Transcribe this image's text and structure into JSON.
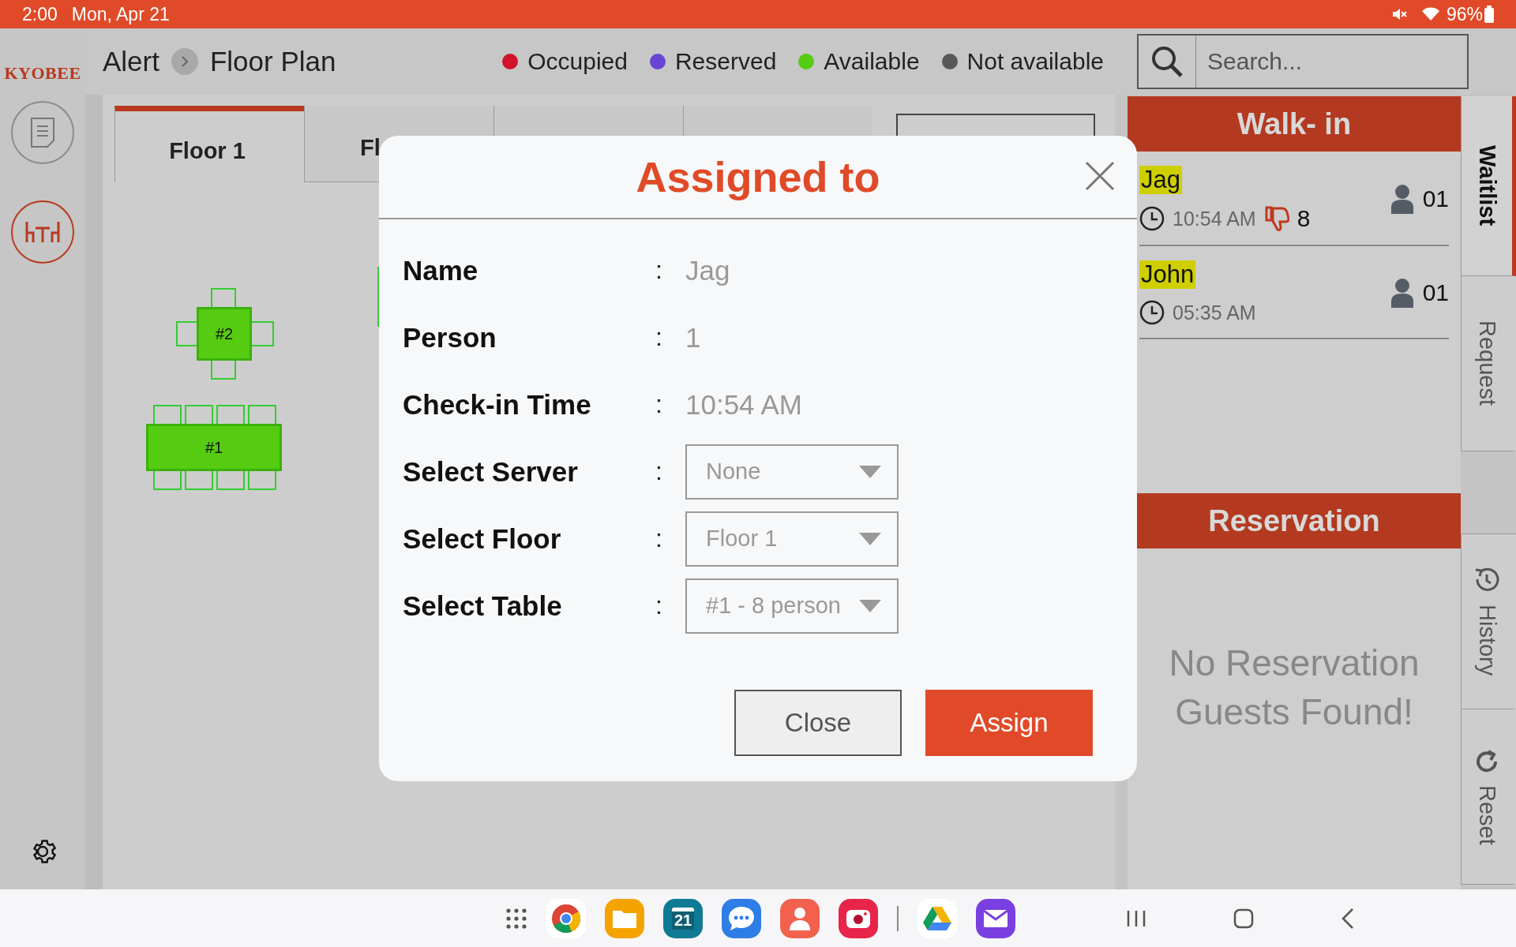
{
  "status_bar": {
    "time": "2:00",
    "date": "Mon, Apr 21",
    "battery": "96%"
  },
  "sidebar": {
    "logo": "KYOBEE",
    "items": [
      {
        "kind": "notes",
        "selected": false
      },
      {
        "kind": "tables",
        "selected": true
      }
    ]
  },
  "header": {
    "breadcrumb": [
      "Alert",
      "Floor Plan"
    ],
    "legend": [
      {
        "label": "Occupied",
        "color": "#d0122c"
      },
      {
        "label": "Reserved",
        "color": "#6a45d4"
      },
      {
        "label": "Available",
        "color": "#55cc11"
      },
      {
        "label": "Not available",
        "color": "#585858"
      }
    ],
    "search": {
      "placeholder": "Search..."
    }
  },
  "floor_tabs": [
    {
      "label": "Floor 1",
      "selected": true
    },
    {
      "label": "Fl",
      "selected": false
    },
    {
      "selected": false
    },
    {
      "selected": false
    }
  ],
  "floor_tables": [
    {
      "label": "#2",
      "kind": "square"
    },
    {
      "label": "#1",
      "kind": "long"
    }
  ],
  "walk_in": {
    "title": "Walk- in",
    "guests": [
      {
        "name": "Jag",
        "time": "10:54 AM",
        "rating": "8",
        "party": "01"
      },
      {
        "name": "John",
        "time": "05:35 AM",
        "party": "01"
      }
    ]
  },
  "reservation": {
    "title": "Reservation",
    "empty": "No Reservation Guests Found!"
  },
  "side_tabs": [
    {
      "label": "Waitlist",
      "kind": "text",
      "selected": true
    },
    {
      "label": "Request",
      "kind": "text",
      "selected": false
    },
    {
      "kind": "gap"
    },
    {
      "label": "History",
      "kind": "history",
      "selected": false
    },
    {
      "label": "Reset",
      "kind": "reset",
      "selected": false
    }
  ],
  "dialog": {
    "title": "Assigned to",
    "fields": [
      {
        "label": "Name",
        "kind": "text",
        "value": "Jag"
      },
      {
        "label": "Person",
        "kind": "text",
        "value": "1"
      },
      {
        "label": "Check-in Time",
        "kind": "text",
        "value": "10:54 AM"
      },
      {
        "label": "Select Server",
        "kind": "select",
        "value": "None"
      },
      {
        "label": "Select Floor",
        "kind": "select",
        "value": "Floor 1"
      },
      {
        "label": "Select Table",
        "kind": "select",
        "value": "#1 - 8 person"
      }
    ],
    "separator": ":",
    "buttons": [
      {
        "label": "Close",
        "kind": "secondary"
      },
      {
        "label": "Assign",
        "kind": "primary"
      }
    ]
  },
  "taskbar": {
    "apps": [
      {
        "kind": "grid"
      },
      {
        "kind": "chrome"
      },
      {
        "kind": "files"
      },
      {
        "kind": "calendar",
        "label": "21"
      },
      {
        "kind": "messages"
      },
      {
        "kind": "contacts"
      },
      {
        "kind": "camera"
      },
      {
        "kind": "divider"
      },
      {
        "kind": "drive"
      },
      {
        "kind": "mail"
      }
    ]
  }
}
